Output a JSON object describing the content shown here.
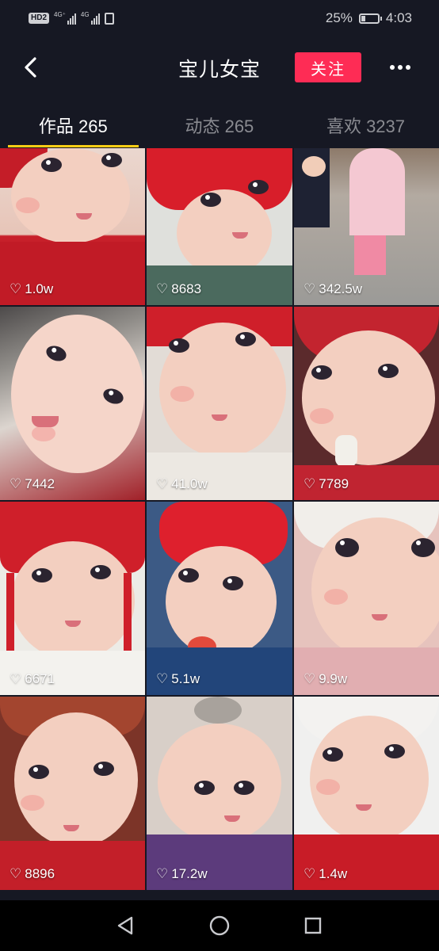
{
  "status_bar": {
    "hd_label": "HD",
    "hd_sub": "2",
    "net1": "4G⁺",
    "net2": "4G",
    "battery_text": "25%",
    "battery_level": 0.25,
    "time": "4:03"
  },
  "header": {
    "title": "宝儿女宝",
    "follow_label": "关注"
  },
  "tabs": [
    {
      "label": "作品 265",
      "active": true
    },
    {
      "label": "动态 265",
      "active": false
    },
    {
      "label": "喜欢 3237",
      "active": false
    }
  ],
  "videos": [
    {
      "likes": "1.0w"
    },
    {
      "likes": "8683"
    },
    {
      "likes": "342.5w"
    },
    {
      "likes": "7442"
    },
    {
      "likes": "41.0w"
    },
    {
      "likes": "7789"
    },
    {
      "likes": "6671"
    },
    {
      "likes": "5.1w"
    },
    {
      "likes": "9.9w"
    },
    {
      "likes": "8896"
    },
    {
      "likes": "17.2w"
    },
    {
      "likes": "1.4w"
    }
  ],
  "colors": {
    "background": "#161823",
    "follow_button": "#fe2c55",
    "tab_indicator": "#face15"
  }
}
